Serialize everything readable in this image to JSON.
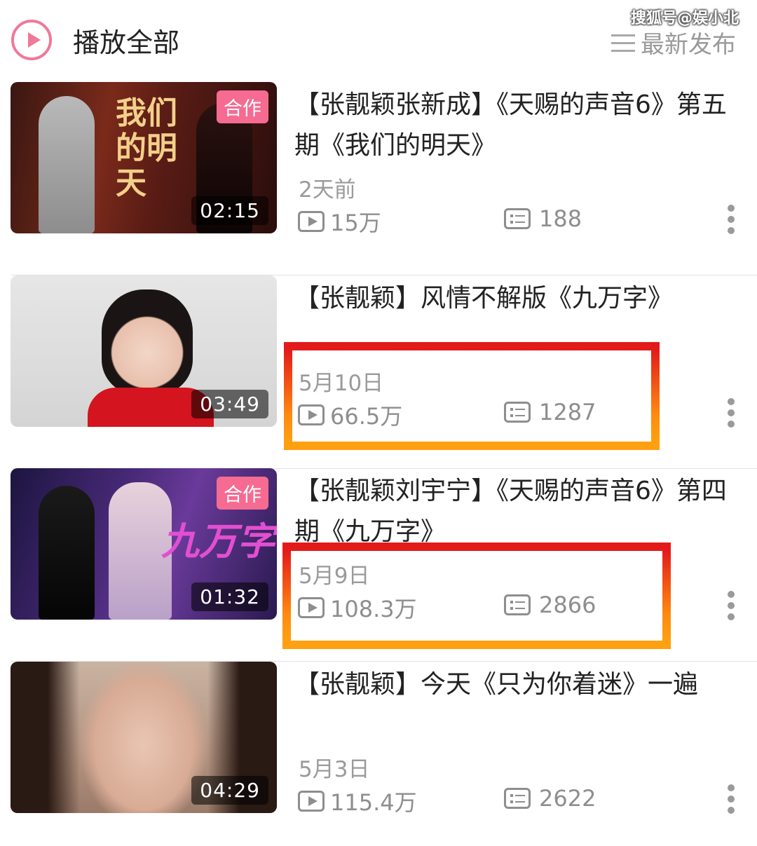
{
  "watermark": "搜狐号@娱小北",
  "header": {
    "play_all_label": "播放全部",
    "sort_label": "最新发布"
  },
  "videos": [
    {
      "title": "【张靓颖张新成】《天赐的声音6》第五期《我们的明天》",
      "date": "2天前",
      "plays": "15万",
      "comments": "188",
      "duration": "02:15",
      "badge": "合作",
      "thumb_text": "我们的明天"
    },
    {
      "title": "【张靓颖】风情不解版《九万字》",
      "date": "5月10日",
      "plays": "66.5万",
      "comments": "1287",
      "duration": "03:49",
      "badge": ""
    },
    {
      "title": "【张靓颖刘宇宁】《天赐的声音6》第四期《九万字》",
      "date": "5月9日",
      "plays": "108.3万",
      "comments": "2866",
      "duration": "01:32",
      "badge": "合作",
      "thumb_text": "九万字"
    },
    {
      "title": "【张靓颖】今天《只为你着迷》一遍",
      "date": "5月3日",
      "plays": "115.4万",
      "comments": "2622",
      "duration": "04:29",
      "badge": ""
    }
  ],
  "colors": {
    "accent": "#f56b92",
    "highlight_top": "#e31a1a",
    "highlight_bottom": "#ffa010"
  }
}
